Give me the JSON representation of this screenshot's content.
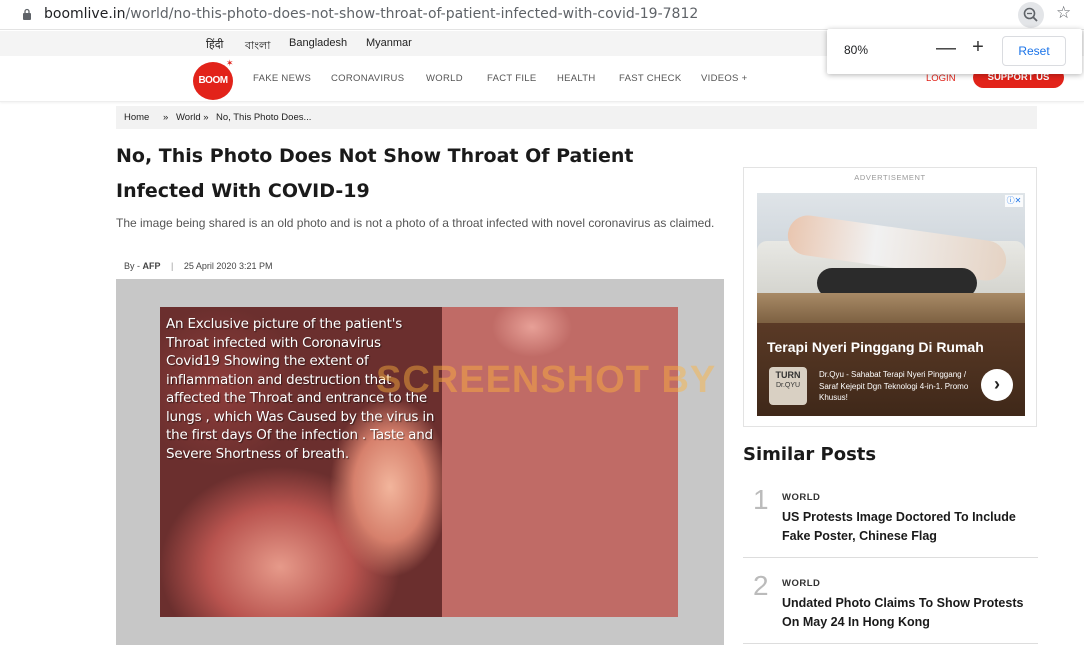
{
  "browser": {
    "url_domain": "boomlive.in",
    "url_path": "/world/no-this-photo-does-not-show-throat-of-patient-infected-with-covid-19-7812",
    "zoom_level": "80%",
    "zoom_minus": "—",
    "zoom_plus": "+",
    "zoom_reset": "Reset"
  },
  "languages": [
    "हिंदी",
    "বাংলা",
    "Bangladesh",
    "Myanmar"
  ],
  "nav": {
    "logo": "BOOM",
    "items": [
      "FAKE NEWS",
      "CORONAVIRUS",
      "WORLD",
      "FACT FILE",
      "HEALTH",
      "FAST CHECK",
      "VIDEOS +"
    ],
    "login": "LOGIN",
    "support": "SUPPORT US"
  },
  "breadcrumb": {
    "home": "Home",
    "sep1": "»",
    "world": "World »",
    "current": "No, This Photo Does..."
  },
  "article": {
    "title": "No, This Photo Does Not Show Throat Of Patient Infected With COVID-19",
    "summary": "The image being shared is an old photo and is not a photo of a throat infected with novel coronavirus as claimed.",
    "by_label": "By -",
    "author": "AFP",
    "divider": "|",
    "date": "25 April 2020 3:21 PM",
    "image_caption": "An Exclusive picture of the patient's Throat infected with Coronavirus Covid19 Showing the extent of inflammation and destruction that affected the Throat  and entrance to the lungs , which Was Caused by the virus in the first days Of the infection . Taste and Severe Shortness of breath.",
    "watermark": "SCREENSHOT BY"
  },
  "ad": {
    "label": "ADVERTISEMENT",
    "headline": "Terapi Nyeri Pinggang Di Rumah",
    "brand_line1": "TURN",
    "brand_line2": "Dr.QYU",
    "description": "Dr.Qyu - Sahabat Terapi Nyeri Pinggang / Saraf Kejepit Dgn Teknologi 4-in-1. Promo Khusus!",
    "arrow": "›"
  },
  "similar": {
    "title": "Similar Posts",
    "posts": [
      {
        "num": "1",
        "category": "WORLD",
        "title": "US Protests Image Doctored To Include Fake Poster, Chinese Flag"
      },
      {
        "num": "2",
        "category": "WORLD",
        "title": "Undated Photo Claims To Show Protests On May 24 In Hong Kong"
      }
    ]
  },
  "colors": {
    "brand_red": "#e2231a",
    "breadcrumb_bg": "#f2f2f2"
  }
}
